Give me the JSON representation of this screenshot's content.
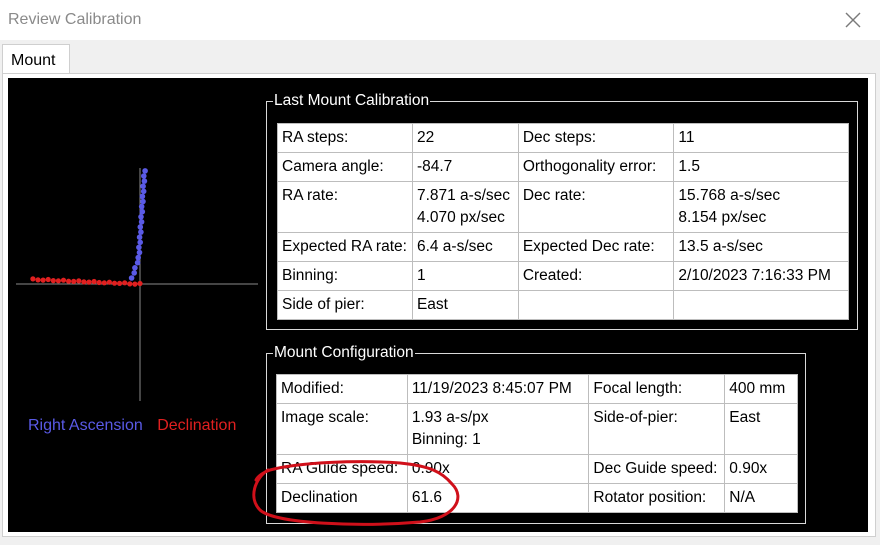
{
  "window": {
    "title": "Review Calibration"
  },
  "tabs": [
    {
      "label": "Mount"
    }
  ],
  "legend": {
    "ra": "Right Ascension",
    "dec": "Declination",
    "ra_color": "#5a5ae6",
    "dec_color": "#e02020"
  },
  "last_calibration": {
    "title": "Last Mount Calibration",
    "rows": [
      [
        "RA steps:",
        "22",
        "Dec steps:",
        "11"
      ],
      [
        "Camera angle:",
        "-84.7",
        "Orthogonality error:",
        "1.5"
      ],
      [
        "RA rate:",
        "7.871 a-s/sec\n4.070 px/sec",
        "Dec rate:",
        "15.768 a-s/sec\n8.154 px/sec"
      ],
      [
        "Expected RA rate:",
        "6.4 a-s/sec",
        "Expected Dec rate:",
        "13.5 a-s/sec"
      ],
      [
        "Binning:",
        "1",
        "Created:",
        "2/10/2023 7:16:33 PM"
      ],
      [
        "Side of pier:",
        "East",
        "",
        ""
      ]
    ]
  },
  "mount_config": {
    "title": "Mount Configuration",
    "rows": [
      [
        "Modified:",
        "11/19/2023 8:45:07 PM",
        "Focal length:",
        "400 mm"
      ],
      [
        "Image scale:",
        "1.93 a-s/px\nBinning: 1",
        "Side-of-pier:",
        "East"
      ],
      [
        "RA Guide speed:",
        "0.90x",
        "Dec Guide speed:",
        "0.90x"
      ],
      [
        "Declination",
        "61.6",
        "Rotator position:",
        "N/A"
      ]
    ]
  },
  "annotation": {
    "color": "#d0101a",
    "shape": "hand-drawn ellipse"
  }
}
